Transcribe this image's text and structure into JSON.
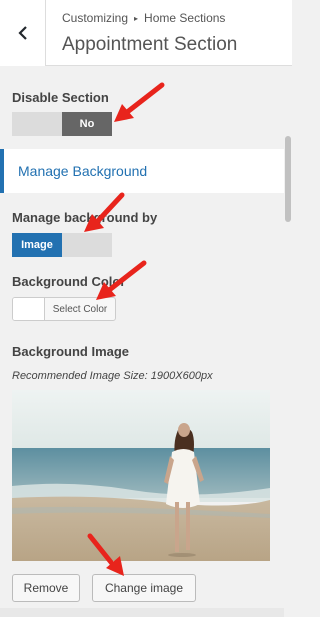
{
  "header": {
    "breadcrumb_root": "Customizing",
    "breadcrumb_separator": "▸",
    "breadcrumb_current": "Home Sections",
    "title": "Appointment Section"
  },
  "disable_section": {
    "label": "Disable Section",
    "value_label": "No"
  },
  "manage_background": {
    "section_label": "Manage Background"
  },
  "manage_background_by": {
    "label": "Manage background by",
    "selected_label": "Image"
  },
  "background_color": {
    "label": "Background Color",
    "button_label": "Select Color",
    "value": "#ffffff"
  },
  "background_image": {
    "label": "Background Image",
    "hint": "Recommended Image Size: 1900X600px",
    "remove_label": "Remove",
    "change_label": "Change image"
  },
  "colors": {
    "accent": "#2271b1",
    "annotation_arrow": "#e8241c"
  }
}
